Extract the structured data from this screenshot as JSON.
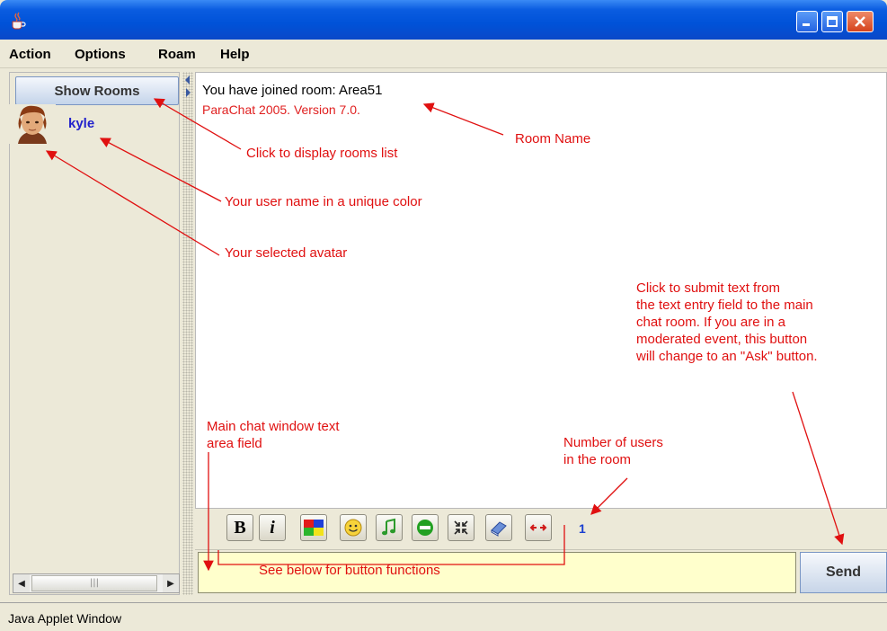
{
  "menu": {
    "items": [
      "Action",
      "Options",
      "Roam",
      "Help"
    ]
  },
  "sidebar": {
    "show_rooms_label": "Show Rooms",
    "user": {
      "name": "kyle",
      "name_color": "#2222cc"
    }
  },
  "chat": {
    "line1": "You have joined room: Area51",
    "line2": "ParaChat 2005. Version 7.0."
  },
  "toolbar": {
    "buttons": [
      "bold",
      "italic",
      "color",
      "smiley",
      "music",
      "stop",
      "collapse",
      "book",
      "expand"
    ],
    "bold_glyph": "B",
    "italic_glyph": "i",
    "user_count": "1"
  },
  "input": {
    "send_label": "Send",
    "value": ""
  },
  "status": {
    "text": "Java Applet Window"
  },
  "annotations": {
    "show_rooms": "Click to display rooms list",
    "room_name": "Room Name",
    "user_name": "Your user name in a unique color",
    "avatar": "Your selected avatar",
    "send": "Click to submit text from\nthe text entry field to the main\nchat room. If you are in a\nmoderated event, this button\nwill change to an \"Ask\" button.",
    "chat_area": "Main chat window text\narea field",
    "user_count": "Number of users\nin the room",
    "buttons": "See below for button functions"
  },
  "colors": {
    "annotation": "#e01010",
    "input_bg": "#ffffcc",
    "titlebar": "#0052d8"
  }
}
